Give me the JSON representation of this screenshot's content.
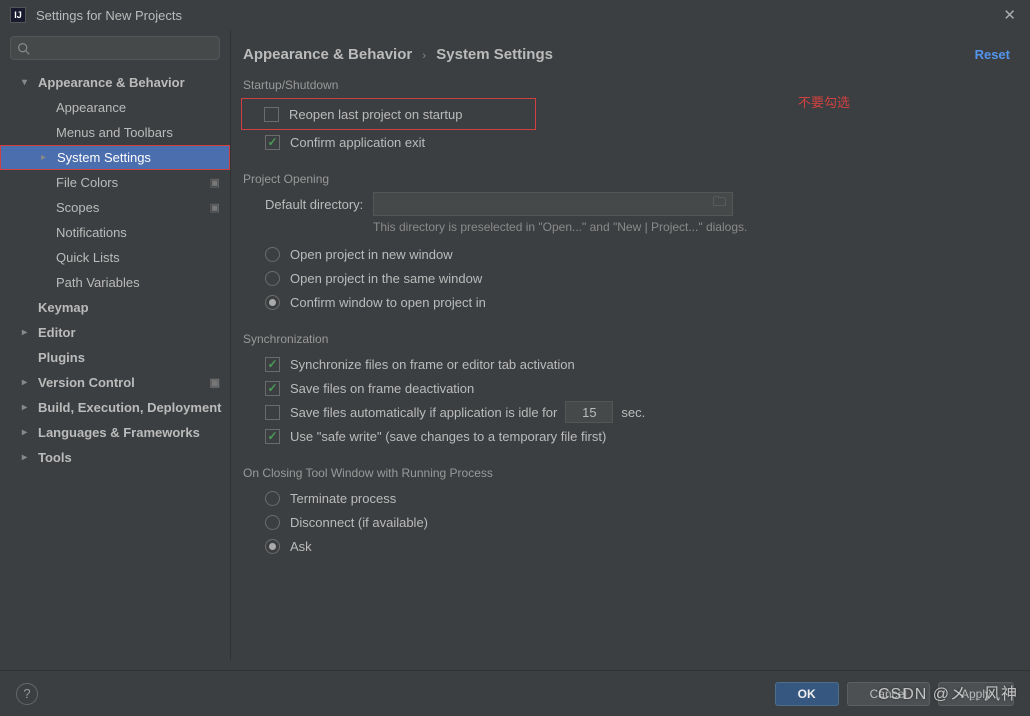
{
  "window": {
    "title": "Settings for New Projects"
  },
  "search": {
    "placeholder": ""
  },
  "tree": {
    "appearance_behavior": "Appearance & Behavior",
    "appearance": "Appearance",
    "menus_toolbars": "Menus and Toolbars",
    "system_settings": "System Settings",
    "file_colors": "File Colors",
    "scopes": "Scopes",
    "notifications": "Notifications",
    "quick_lists": "Quick Lists",
    "path_variables": "Path Variables",
    "keymap": "Keymap",
    "editor": "Editor",
    "plugins": "Plugins",
    "version_control": "Version Control",
    "build": "Build, Execution, Deployment",
    "languages": "Languages & Frameworks",
    "tools": "Tools"
  },
  "breadcrumb": {
    "root": "Appearance & Behavior",
    "leaf": "System Settings",
    "reset": "Reset"
  },
  "annotations": {
    "dont_check": "不要勾选"
  },
  "startup": {
    "header": "Startup/Shutdown",
    "reopen": "Reopen last project on startup",
    "confirm_exit": "Confirm application exit"
  },
  "project_opening": {
    "header": "Project Opening",
    "dir_label": "Default directory:",
    "hint": "This directory is preselected in \"Open...\" and \"New | Project...\" dialogs.",
    "new_window": "Open project in new window",
    "same_window": "Open project in the same window",
    "confirm": "Confirm window to open project in"
  },
  "sync": {
    "header": "Synchronization",
    "on_activation": "Synchronize files on frame or editor tab activation",
    "on_deactivation": "Save files on frame deactivation",
    "idle_prefix": "Save files automatically if application is idle for",
    "idle_value": "15",
    "idle_suffix": "sec.",
    "safe_write": "Use \"safe write\" (save changes to a temporary file first)"
  },
  "closing": {
    "header": "On Closing Tool Window with Running Process",
    "terminate": "Terminate process",
    "disconnect": "Disconnect (if available)",
    "ask": "Ask"
  },
  "footer": {
    "ok": "OK",
    "cancel": "Cancel",
    "apply": "Apply"
  },
  "watermark": "CSDN @メ﹎风神"
}
